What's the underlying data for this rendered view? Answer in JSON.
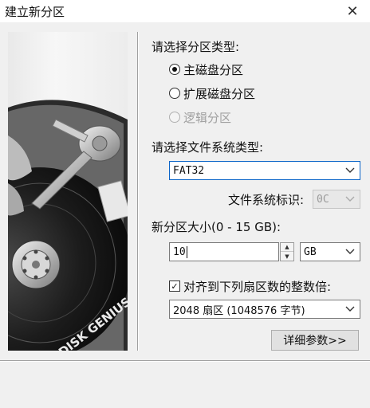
{
  "window": {
    "title": "建立新分区",
    "close_icon": "✕"
  },
  "partition_type": {
    "label": "请选择分区类型:",
    "options": [
      {
        "label": "主磁盘分区",
        "checked": true,
        "disabled": false
      },
      {
        "label": "扩展磁盘分区",
        "checked": false,
        "disabled": false
      },
      {
        "label": "逻辑分区",
        "checked": false,
        "disabled": true
      }
    ]
  },
  "filesystem": {
    "label": "请选择文件系统类型:",
    "value": "FAT32",
    "id_label": "文件系统标识:",
    "id_value": "0C"
  },
  "size": {
    "label": "新分区大小(0 - 15 GB):",
    "value": "10",
    "unit": "GB"
  },
  "align": {
    "label": "对齐到下列扇区数的整数倍:",
    "checked": true,
    "check_glyph": "✓",
    "value": "2048 扇区 (1048576 字节)"
  },
  "details_button": "详细参数>>",
  "icons": {
    "dropdown": "chevron-down-icon",
    "spin_up": "▲",
    "spin_down": "▼",
    "combo_arrow": "⌵"
  },
  "art_logo": "DISK GENIUS"
}
